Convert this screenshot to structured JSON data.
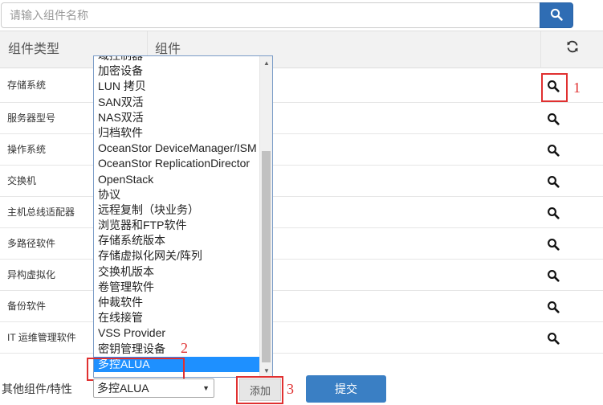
{
  "search": {
    "placeholder": "请输入组件名称",
    "button_icon": "search-icon",
    "button_color": "#2f6db4"
  },
  "table": {
    "header": {
      "type_label": "组件类型",
      "component_label": "组件",
      "refresh_icon": "refresh-icon"
    },
    "rows": [
      {
        "type": "存储系统"
      },
      {
        "type": "服务器型号"
      },
      {
        "type": "操作系统"
      },
      {
        "type": "交换机"
      },
      {
        "type": "主机总线适配器"
      },
      {
        "type": "多路径软件"
      },
      {
        "type": "异构虚拟化"
      },
      {
        "type": "备份软件"
      },
      {
        "type": "IT 运维管理软件"
      }
    ]
  },
  "dropdown": {
    "items": [
      "域控制器",
      "加密设备",
      "LUN 拷贝",
      "SAN双活",
      "NAS双活",
      "归档软件",
      "OceanStor DeviceManager/ISM",
      "OceanStor ReplicationDirector",
      "OpenStack",
      "协议",
      "远程复制（块业务）",
      "浏览器和FTP软件",
      "存储系统版本",
      "存储虚拟化网关/阵列",
      "交换机版本",
      "卷管理软件",
      "仲裁软件",
      "在线接管",
      "VSS Provider",
      "密钥管理设备",
      "多控ALUA"
    ],
    "selected_item": "多控ALUA",
    "selected_color": "#1e90ff"
  },
  "footer": {
    "label": "其他组件/特性",
    "select_value": "多控ALUA",
    "add_label": "添加",
    "submit_label": "提交",
    "submit_color": "#3a7fc4"
  },
  "annotations": {
    "n1": "1",
    "n2": "2",
    "n3": "3",
    "color": "#e03030"
  }
}
